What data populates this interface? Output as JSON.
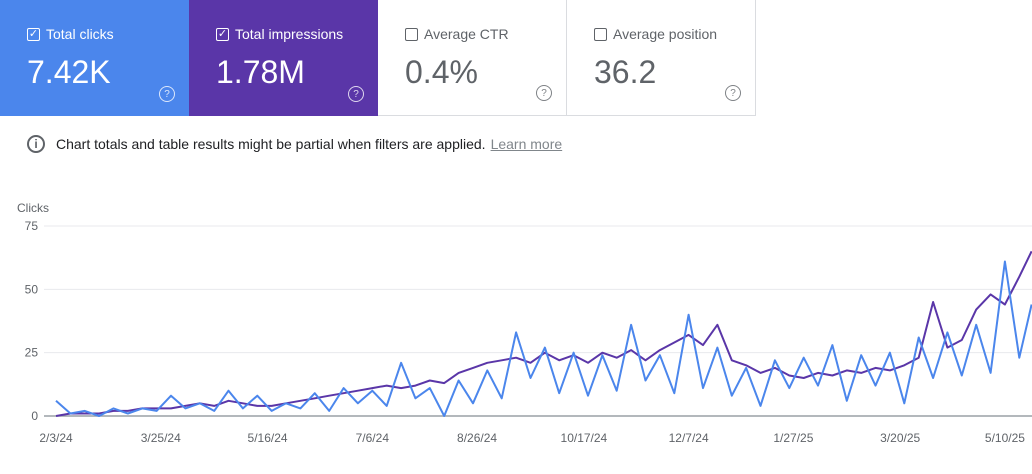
{
  "cards": [
    {
      "label": "Total clicks",
      "value": "7.42K",
      "checked": true,
      "color": "#4b86ec"
    },
    {
      "label": "Total impressions",
      "value": "1.78M",
      "checked": true,
      "color": "#5a36a8"
    },
    {
      "label": "Average CTR",
      "value": "0.4%",
      "checked": false
    },
    {
      "label": "Average position",
      "value": "36.2",
      "checked": false
    }
  ],
  "info": {
    "text": "Chart totals and table results might be partial when filters are applied.",
    "link": "Learn more",
    "icon": "info-icon"
  },
  "chart_data": {
    "type": "line",
    "ylabel": "Clicks",
    "ylim": [
      0,
      75
    ],
    "yticks": [
      0,
      25,
      50,
      75
    ],
    "xticks": [
      "2/3/24",
      "3/25/24",
      "5/16/24",
      "7/6/24",
      "8/26/24",
      "10/17/24",
      "12/7/24",
      "1/27/25",
      "3/20/25",
      "5/10/25"
    ],
    "grid": true,
    "x": [
      "2/3/24",
      "2/10/24",
      "2/17/24",
      "2/24/24",
      "3/2/24",
      "3/9/24",
      "3/16/24",
      "3/23/24",
      "3/30/24",
      "4/6/24",
      "4/13/24",
      "4/20/24",
      "4/27/24",
      "5/4/24",
      "5/11/24",
      "5/18/24",
      "5/25/24",
      "6/1/24",
      "6/8/24",
      "6/15/24",
      "6/22/24",
      "6/29/24",
      "7/6/24",
      "7/13/24",
      "7/20/24",
      "7/27/24",
      "8/3/24",
      "8/10/24",
      "8/17/24",
      "8/24/24",
      "8/31/24",
      "9/7/24",
      "9/14/24",
      "9/21/24",
      "9/28/24",
      "10/5/24",
      "10/12/24",
      "10/19/24",
      "10/26/24",
      "11/2/24",
      "11/9/24",
      "11/16/24",
      "11/23/24",
      "11/30/24",
      "12/7/24",
      "12/14/24",
      "12/21/24",
      "12/28/24",
      "1/4/25",
      "1/11/25",
      "1/18/25",
      "1/25/25",
      "2/1/25",
      "2/8/25",
      "2/15/25",
      "2/22/25",
      "3/1/25",
      "3/8/25",
      "3/15/25",
      "3/22/25",
      "3/29/25",
      "4/5/25",
      "4/12/25",
      "4/19/25",
      "4/26/25",
      "5/3/25",
      "5/10/25",
      "5/17/25",
      "5/23/25"
    ],
    "series": [
      {
        "color": "#4b86ec",
        "values": [
          6,
          1,
          2,
          0,
          3,
          1,
          3,
          2,
          8,
          3,
          5,
          2,
          10,
          3,
          8,
          2,
          5,
          3,
          9,
          2,
          11,
          5,
          10,
          4,
          21,
          7,
          11,
          0,
          14,
          5,
          18,
          7,
          33,
          15,
          27,
          9,
          25,
          8,
          24,
          10,
          36,
          14,
          24,
          9,
          40,
          11,
          27,
          8,
          19,
          4,
          22,
          11,
          23,
          12,
          28,
          6,
          24,
          12,
          25,
          5,
          31,
          15,
          33,
          16,
          36,
          17,
          61,
          23,
          44
        ]
      },
      {
        "color": "#5a36a8",
        "values": [
          0,
          1,
          1,
          1,
          2,
          2,
          3,
          3,
          3,
          4,
          5,
          4,
          6,
          5,
          4,
          4,
          5,
          6,
          7,
          8,
          9,
          10,
          11,
          12,
          11,
          12,
          14,
          13,
          17,
          19,
          21,
          22,
          23,
          21,
          25,
          22,
          24,
          21,
          25,
          23,
          26,
          22,
          26,
          29,
          32,
          28,
          36,
          22,
          20,
          17,
          19,
          16,
          15,
          17,
          16,
          18,
          17,
          19,
          18,
          20,
          23,
          45,
          27,
          30,
          42,
          48,
          44,
          55,
          65
        ]
      }
    ]
  }
}
